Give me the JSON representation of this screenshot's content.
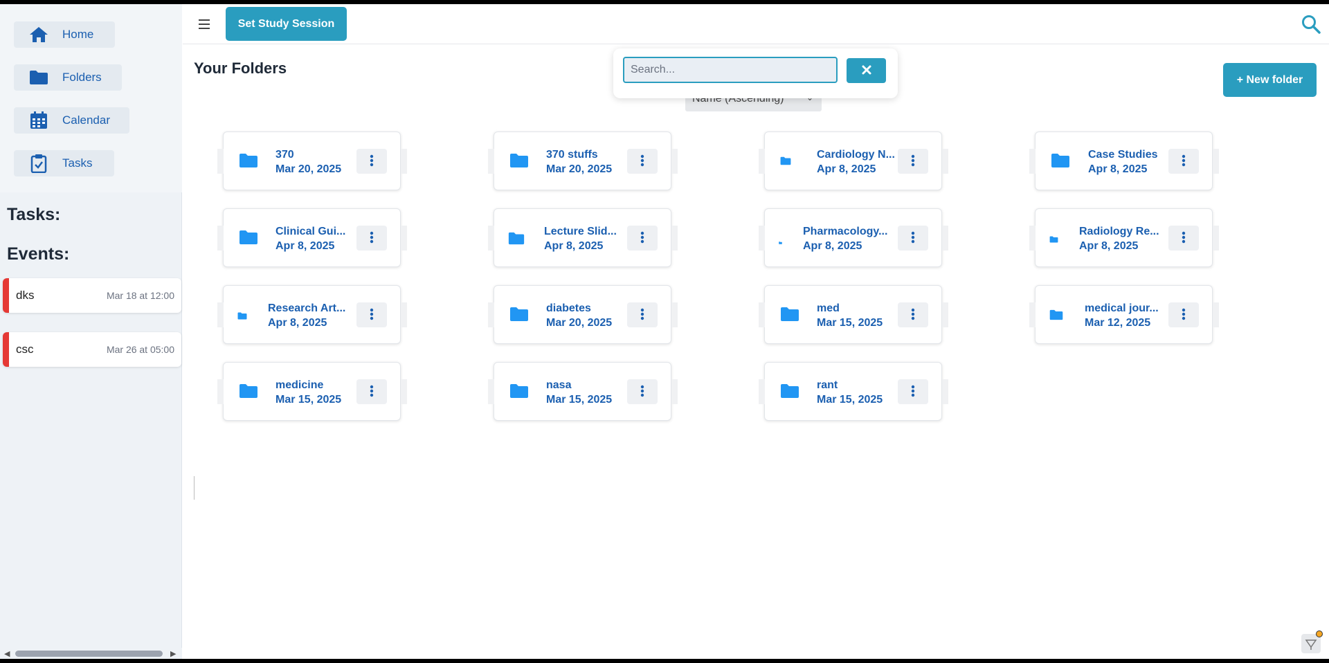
{
  "sidebar": {
    "nav": [
      {
        "label": "Home",
        "icon": "home-icon"
      },
      {
        "label": "Folders",
        "icon": "folder-icon"
      },
      {
        "label": "Calendar",
        "icon": "calendar-icon"
      },
      {
        "label": "Tasks",
        "icon": "clipboard-check-icon"
      }
    ],
    "tasks_heading": "Tasks:",
    "events_heading": "Events:",
    "events": [
      {
        "name": "dks",
        "time": "Mar 18 at 12:00"
      },
      {
        "name": "csc",
        "time": "Mar 26 at 05:00"
      }
    ]
  },
  "header": {
    "study_button": "Set Study Session"
  },
  "main": {
    "title": "Your Folders",
    "sort_value": "Name (Ascending)",
    "new_folder_button": "+ New folder",
    "search": {
      "placeholder": "Search...",
      "value": ""
    },
    "folders": [
      {
        "name": "370",
        "date": "Mar 20, 2025"
      },
      {
        "name": "370 stuffs",
        "date": "Mar 20, 2025"
      },
      {
        "name": "Cardiology N...",
        "date": "Apr 8, 2025"
      },
      {
        "name": "Case Studies",
        "date": "Apr 8, 2025"
      },
      {
        "name": "Clinical Gui...",
        "date": "Apr 8, 2025"
      },
      {
        "name": "Lecture Slid...",
        "date": "Apr 8, 2025"
      },
      {
        "name": "Pharmacology...",
        "date": "Apr 8, 2025"
      },
      {
        "name": "Radiology Re...",
        "date": "Apr 8, 2025"
      },
      {
        "name": "Research Art...",
        "date": "Apr 8, 2025"
      },
      {
        "name": "diabetes",
        "date": "Mar 20, 2025"
      },
      {
        "name": "med",
        "date": "Mar 15, 2025"
      },
      {
        "name": "medical jour...",
        "date": "Mar 12, 2025"
      },
      {
        "name": "medicine",
        "date": "Mar 15, 2025"
      },
      {
        "name": "nasa",
        "date": "Mar 15, 2025"
      },
      {
        "name": "rant",
        "date": "Mar 15, 2025"
      }
    ]
  },
  "colors": {
    "accent": "#2a9dbf",
    "link": "#1b5fb0",
    "folder_icon": "#2196f3",
    "event_marker": "#e53935"
  }
}
